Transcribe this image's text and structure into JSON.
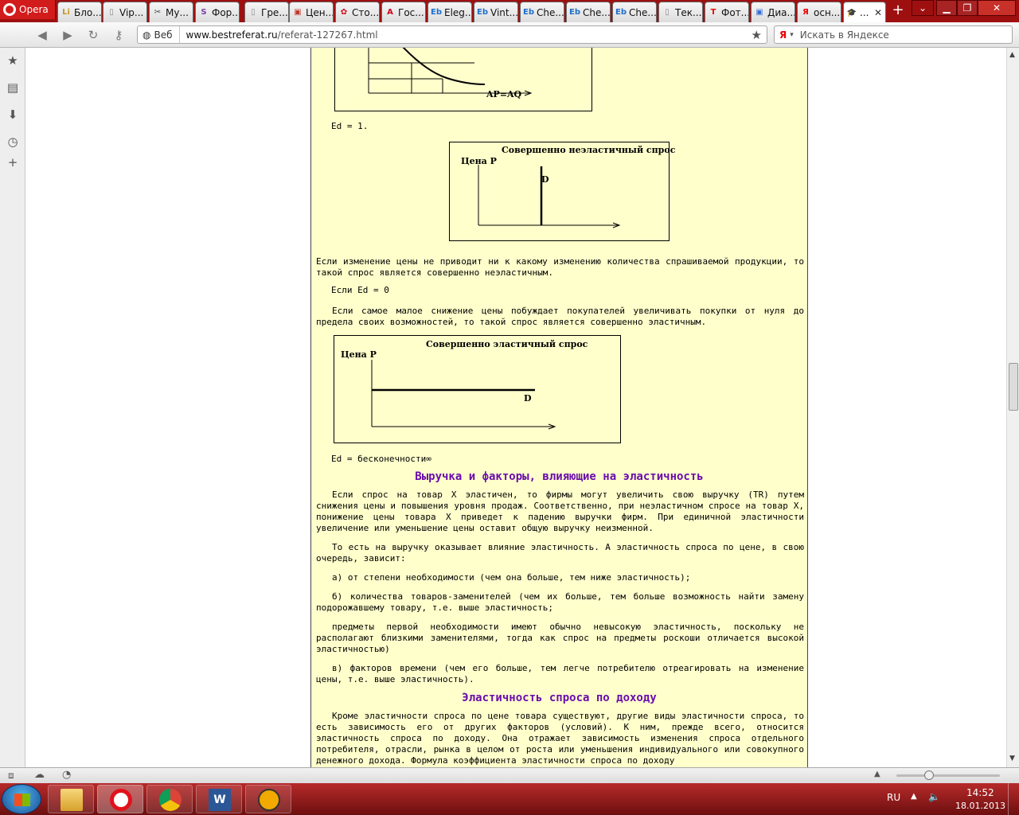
{
  "browser": {
    "menu_label": "Opera",
    "tabs": [
      {
        "label": "Бло...",
        "icon": "li-icon"
      },
      {
        "label": "Vip...",
        "icon": "page-icon"
      },
      {
        "label": "Му...",
        "icon": "scissors-icon"
      },
      {
        "label": "Фор...",
        "icon": "s-icon"
      },
      {
        "label": "Гре...",
        "icon": "page-icon"
      },
      {
        "label": "Цен...",
        "icon": "red-site-icon"
      },
      {
        "label": "Сто...",
        "icon": "gear-red-icon"
      },
      {
        "label": "Гос...",
        "icon": "a-red-icon"
      },
      {
        "label": "Eleg...",
        "icon": "eb-icon"
      },
      {
        "label": "Vint...",
        "icon": "eb-icon"
      },
      {
        "label": "Che...",
        "icon": "eb-icon"
      },
      {
        "label": "Che...",
        "icon": "eb-icon"
      },
      {
        "label": "Che...",
        "icon": "eb-icon"
      },
      {
        "label": "Тек...",
        "icon": "page-icon"
      },
      {
        "label": "Фот...",
        "icon": "t-red-icon"
      },
      {
        "label": "Диа...",
        "icon": "blue-site-icon"
      },
      {
        "label": "осн...",
        "icon": "yandex-icon"
      },
      {
        "label": "...",
        "icon": "mortarboard-icon"
      }
    ],
    "active_tab": 17,
    "address": {
      "security_label": "Веб",
      "domain": "www.bestreferat.ru",
      "path": "/referat-127267.html"
    },
    "search": {
      "engine_label": "Я",
      "placeholder": "Искать в Яндексе"
    }
  },
  "document": {
    "fig_top": {
      "axis_label": "AP=AQ"
    },
    "ed_equals_1": "Ed = 1.",
    "fig_inelastic": {
      "title": "Совершенно неэластичный спрос",
      "ylabel": "Цена  P",
      "curve_label": "D"
    },
    "para_inelastic": "Если изменение цены не приводит ни к какому изменению количества спрашиваемой продукции, то такой спрос является совершенно неэластичным.",
    "ed_equals_0": "Если Ed = 0",
    "para_elastic": "Если самое малое снижение цены побуждает покупателей увеличивать покупки от нуля до предела своих возможностей, то такой спрос является совершенно эластичным.",
    "fig_elastic": {
      "title": "Совершенно эластичный спрос",
      "ylabel": "Цена  P",
      "curve_label": "D"
    },
    "ed_infinity": "Ed = бесконечности∞",
    "heading_revenue": "Выручка и факторы, влияющие на эластичность",
    "para_revenue_1": "Если спрос на товар X эластичен, то фирмы могут увеличить свою выручку (TR) путем снижения цены и повышения уровня продаж. Соответственно, при неэластичном спросе на товар X, понижение цены товара X приведет к падению выручки фирм. При единичной эластичности увеличение или уменьшение цены оставит общую выручку неизменной.",
    "para_revenue_2": "То есть на выручку оказывает влияние эластичность. А эластичность спроса по цене, в свою очередь, зависит:",
    "factor_a": "а) от степени необходимости (чем она больше, тем ниже эластичность);",
    "factor_b": "б) количества товаров-заменителей (чем их больше, тем больше возможность найти замену подорожавшему товару, т.е. выше эластичность;",
    "factor_note": "предметы первой необходимости имеют обычно невысокую эластичность, поскольку не располагают близкими заменителями, тогда как спрос на предметы роскоши отличается высокой эластичностью)",
    "factor_c": "в) факторов времени (чем его больше, тем легче потребителю отреагировать на изменение цены, т.е. выше эластичность).",
    "heading_income": "Эластичность спроса по доходу",
    "para_income": "Кроме эластичности спроса по цене товара существуют, другие виды эластичности спроса, то есть зависимость его от других факторов (условий). К ним, прежде всего, относится эластичность спроса по доходу. Она отражает зависимость изменения спроса отдельного потребителя, отрасли, рынка в целом от роста или уменьшения индивидуального или совокупного денежного дохода. Формула коэффициента эластичности спроса по доходу"
  },
  "taskbar": {
    "language": "RU",
    "time": "14:52",
    "date": "18.01.2013"
  },
  "colors": {
    "tabbar": "#9e1010",
    "paper": "#ffffcc",
    "heading": "#6a0dad",
    "taskbar": "#8b1515"
  }
}
